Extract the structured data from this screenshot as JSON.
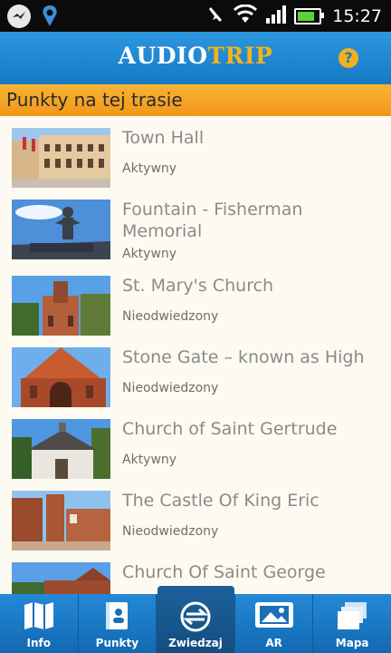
{
  "status_bar": {
    "time": "15:27",
    "battery_level": 0.8,
    "icons": [
      "messenger-icon",
      "location-app-icon",
      "mute-icon",
      "wifi-icon",
      "signal-icon",
      "battery-icon"
    ]
  },
  "app_bar": {
    "logo_part1": "AUDIO",
    "logo_part2": "TRIP",
    "help_label": "?"
  },
  "section_header": "Punkty na tej trasie",
  "points": [
    {
      "title": "Town Hall",
      "status": "Aktywny"
    },
    {
      "title": "Fountain - Fisherman Memorial",
      "status": "Aktywny"
    },
    {
      "title": "St. Mary's Church",
      "status": "Nieodwiedzony"
    },
    {
      "title": "Stone Gate – known as High",
      "status": "Nieodwiedzony"
    },
    {
      "title": "Church of Saint Gertrude",
      "status": "Aktywny"
    },
    {
      "title": "The Castle Of King Eric",
      "status": "Nieodwiedzony"
    },
    {
      "title": "Church Of Saint George",
      "status": ""
    }
  ],
  "bottom_nav": [
    {
      "label": "Info",
      "icon": "map-book-icon"
    },
    {
      "label": "Punkty",
      "icon": "points-book-icon"
    },
    {
      "label": "Zwiedzaj",
      "icon": "explore-compass-icon",
      "active": true
    },
    {
      "label": "AR",
      "icon": "ar-picture-icon"
    },
    {
      "label": "Mapa",
      "icon": "map-stack-icon"
    }
  ],
  "colors": {
    "app_bar": "#1b82cf",
    "accent_orange": "#f3a024",
    "logo_trip": "#f5b21d",
    "list_bg": "#fdfbf1"
  }
}
